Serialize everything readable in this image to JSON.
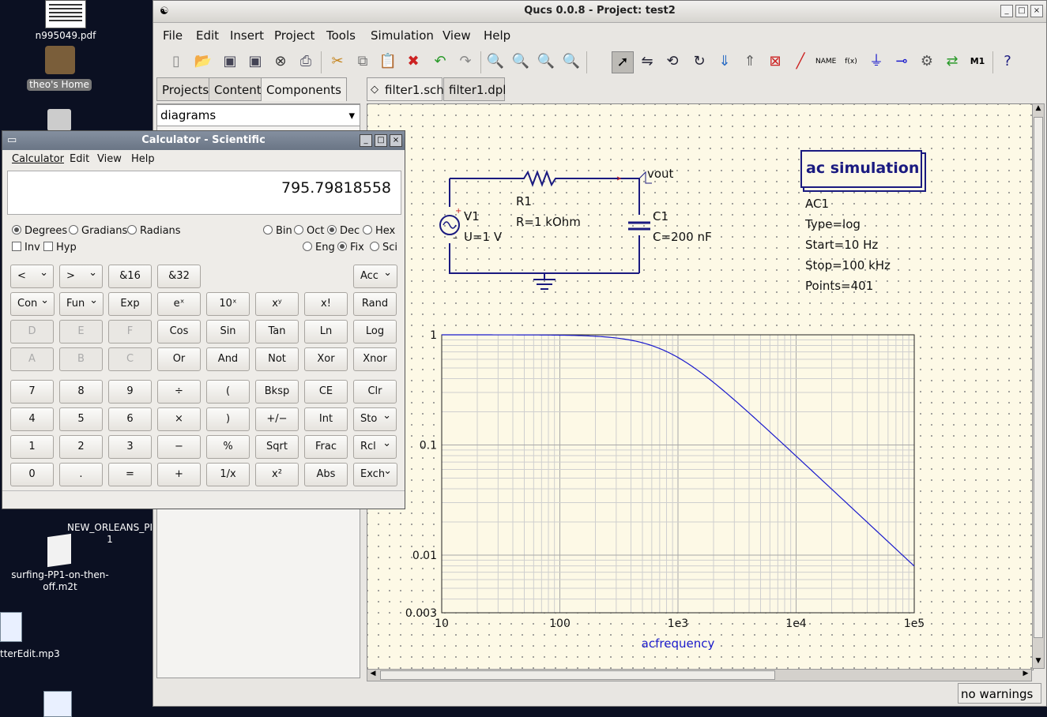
{
  "desktop": {
    "icons": [
      {
        "label": "n995049.pdf"
      },
      {
        "label": "theo's Home"
      },
      {
        "label": "NEW_ORLEANS_PI 1"
      },
      {
        "label": "surfing-PP1-on-then-off.m2t"
      },
      {
        "label": "tterEdit.mp3"
      }
    ]
  },
  "qucs": {
    "title": "Qucs 0.0.8 - Project: test2",
    "menu": [
      "File",
      "Edit",
      "Insert",
      "Project",
      "Tools",
      "Simulation",
      "View",
      "Help"
    ],
    "side_tabs": [
      "Projects",
      "Content",
      "Components"
    ],
    "doc_tabs": [
      "filter1.sch",
      "filter1.dpl"
    ],
    "component_group": "diagrams",
    "status": "no warnings",
    "schematic": {
      "source_name": "V1",
      "source_value": "U=1 V",
      "resistor_name": "R1",
      "resistor_value": "R=1 kOhm",
      "cap_name": "C1",
      "cap_value": "C=200 nF",
      "node_label": "vout",
      "sim_title": "ac simulation",
      "sim_name": "AC1",
      "sim_type": "Type=log",
      "sim_start": "Start=10 Hz",
      "sim_stop": "Stop=100 kHz",
      "sim_points": "Points=401"
    }
  },
  "chart_data": {
    "type": "line",
    "xlabel": "acfrequency",
    "x_scale": "log",
    "y_scale": "log",
    "xlim": [
      10,
      100000
    ],
    "ylim": [
      0.003,
      1
    ],
    "x_ticks": [
      "10",
      "100",
      "1e3",
      "1e4",
      "1e5"
    ],
    "y_ticks": [
      "1",
      "0.1",
      "0.01",
      "0.003"
    ],
    "series": [
      {
        "color": "#1a1acc",
        "x": [
          10,
          100,
          300,
          500,
          795.8,
          1000,
          2000,
          5000,
          10000,
          20000,
          50000,
          100000
        ],
        "values": [
          1.0,
          0.9999,
          0.9357,
          0.8467,
          0.7071,
          0.6227,
          0.3697,
          0.1572,
          0.0793,
          0.0398,
          0.0159,
          0.008
        ]
      }
    ]
  },
  "calculator": {
    "title": "Calculator - Scientific",
    "menu": [
      "Calculator",
      "Edit",
      "View",
      "Help"
    ],
    "display": "795.79818558",
    "angle_modes": [
      "Degrees",
      "Gradians",
      "Radians"
    ],
    "bases": [
      "Bin",
      "Oct",
      "Dec",
      "Hex"
    ],
    "inv": "Inv",
    "hyp": "Hyp",
    "formats": [
      "Eng",
      "Fix",
      "Sci"
    ],
    "rows": [
      [
        "<",
        ">",
        "&16",
        "&32",
        "",
        "",
        "",
        "Acc"
      ],
      [
        "Con",
        "Fun",
        "Exp",
        "eˣ",
        "10ˣ",
        "xʸ",
        "x!",
        "Rand"
      ],
      [
        "D",
        "E",
        "F",
        "Cos",
        "Sin",
        "Tan",
        "Ln",
        "Log"
      ],
      [
        "A",
        "B",
        "C",
        "Or",
        "And",
        "Not",
        "Xor",
        "Xnor"
      ],
      [
        "7",
        "8",
        "9",
        "÷",
        "(",
        "Bksp",
        "CE",
        "Clr"
      ],
      [
        "4",
        "5",
        "6",
        "×",
        ")",
        "+/−",
        "Int",
        "Sto"
      ],
      [
        "1",
        "2",
        "3",
        "−",
        "%",
        "Sqrt",
        "Frac",
        "Rcl"
      ],
      [
        "0",
        ".",
        "=",
        "+",
        "1/x",
        "x²",
        "Abs",
        "Exch"
      ]
    ]
  }
}
